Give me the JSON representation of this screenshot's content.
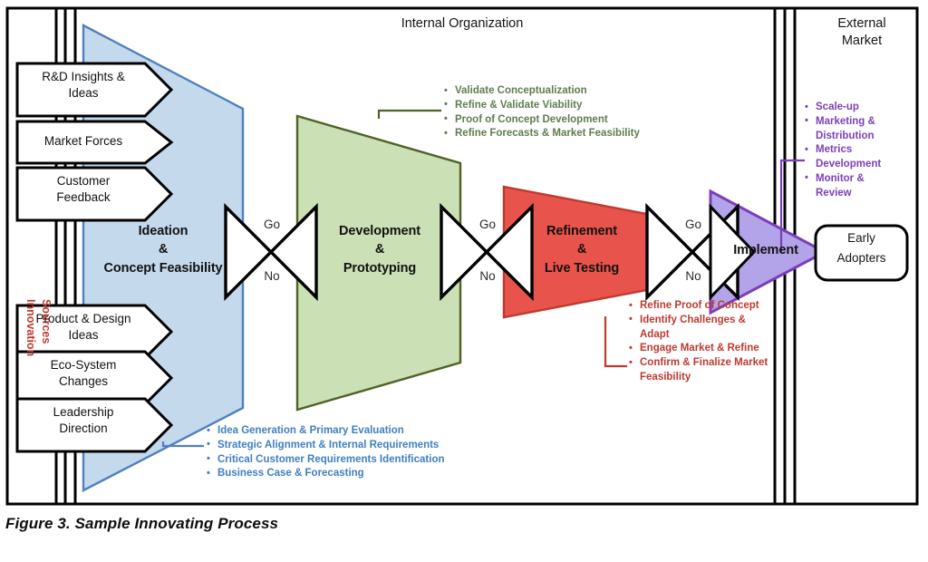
{
  "figure": {
    "caption": "Figure 3. Sample Innovating Process",
    "zones": {
      "internal": "Internal Organization",
      "external_line1": "External",
      "external_line2": "Market"
    },
    "side_label": {
      "line1": "Innovation",
      "line2": "Sources"
    }
  },
  "inputs": [
    {
      "line1": "R&D Insights &",
      "line2": "Ideas"
    },
    {
      "line1": "Market Forces",
      "line2": ""
    },
    {
      "line1": "Customer",
      "line2": "Feedback"
    },
    {
      "line1": "Product & Design",
      "line2": "Ideas"
    },
    {
      "line1": "Eco-System",
      "line2": "Changes"
    },
    {
      "line1": "Leadership",
      "line2": "Direction"
    }
  ],
  "stages": [
    {
      "id": "ideation",
      "line1": "Ideation",
      "line2": "&",
      "line3": "Concept Feasibility",
      "color": "#c5d9ed",
      "stroke": "#4f81bd"
    },
    {
      "id": "development",
      "line1": "Development",
      "line2": "&",
      "line3": "Prototyping",
      "color": "#cbe0b4",
      "stroke": "#4f6228"
    },
    {
      "id": "refinement",
      "line1": "Refinement",
      "line2": "&",
      "line3": "Live Testing",
      "color": "#e8544b",
      "stroke": "#c0392f"
    },
    {
      "id": "implement",
      "line1": "Implement",
      "line2": "",
      "line3": "",
      "color": "#b3a3e8",
      "stroke": "#7b3fb8"
    }
  ],
  "gates": [
    {
      "go": "Go",
      "no": "No"
    },
    {
      "go": "Go",
      "no": "No"
    },
    {
      "go": "Go",
      "no": "No"
    }
  ],
  "outcome": {
    "line1": "Early",
    "line2": "Adopters"
  },
  "callouts": {
    "development": [
      "Validate Conceptualization",
      "Refine & Validate Viability",
      "Proof of Concept Development",
      "Refine Forecasts & Market Feasibility"
    ],
    "ideation": [
      "Idea Generation & Primary Evaluation",
      "Strategic Alignment & Internal Requirements",
      "Critical Customer Requirements Identification",
      "Business Case & Forecasting"
    ],
    "refinement": [
      "Refine Proof of Concept",
      "Identify Challenges & Adapt",
      "Engage Market & Refine",
      "Confirm & Finalize Market Feasibility"
    ],
    "implement": [
      "Scale-up",
      "Marketing & Distribution",
      "Metrics Development",
      "Monitor & Review"
    ]
  },
  "colors": {
    "blue_fill": "#c5d9ed",
    "blue_stroke": "#4f81bd",
    "green_fill": "#cbe0b4",
    "green_stroke": "#4f6228",
    "red_fill": "#e8544b",
    "red_stroke": "#c0392f",
    "purple_fill": "#b3a3e8",
    "purple_stroke": "#7b3fb8",
    "frame": "#000000",
    "text_green": "#5f7d4f",
    "text_blue": "#3f7fc1",
    "text_red": "#c0392f",
    "text_purple": "#7b3fb8",
    "side_text_red": "#c0392f"
  }
}
